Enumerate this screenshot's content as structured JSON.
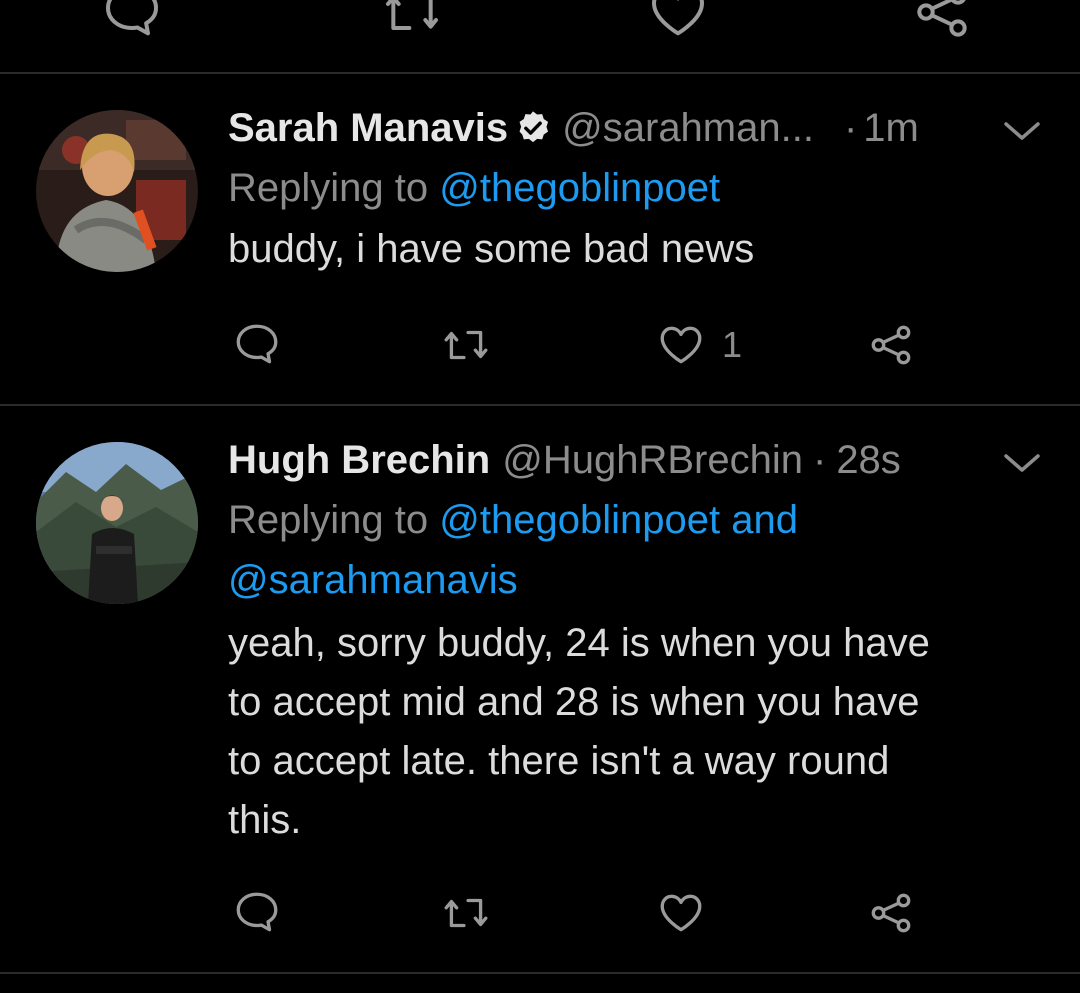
{
  "tweets": [
    {
      "name": "Sarah Manavis",
      "verified": true,
      "handle": "@sarahman...",
      "time": "1m",
      "replying_label": "Replying to",
      "replying_to": "@thegoblinpoet",
      "replying_and": "",
      "replying_to_2": "",
      "text": "buddy, i have some bad news",
      "likes": "1"
    },
    {
      "name": "Hugh Brechin",
      "verified": false,
      "handle": "@HughRBrechin",
      "time": "28s",
      "replying_label": "Replying to",
      "replying_to": "@thegoblinpoet",
      "replying_and": "and",
      "replying_to_2": "@sarahmanavis",
      "text_lines": [
        "yeah, sorry buddy, 24 is when you have",
        "to accept mid and 28 is when you have",
        "to accept late. there isn't a way round",
        "this."
      ],
      "likes": ""
    }
  ],
  "separator_dot": "·",
  "colors": {
    "background": "#000000",
    "link": "#1d9bf0",
    "muted": "#8c8c8c",
    "divider": "#2a2a2a"
  },
  "icons": [
    "reply-icon",
    "retweet-icon",
    "like-icon",
    "share-icon",
    "verified-icon",
    "chevron-down-icon"
  ]
}
